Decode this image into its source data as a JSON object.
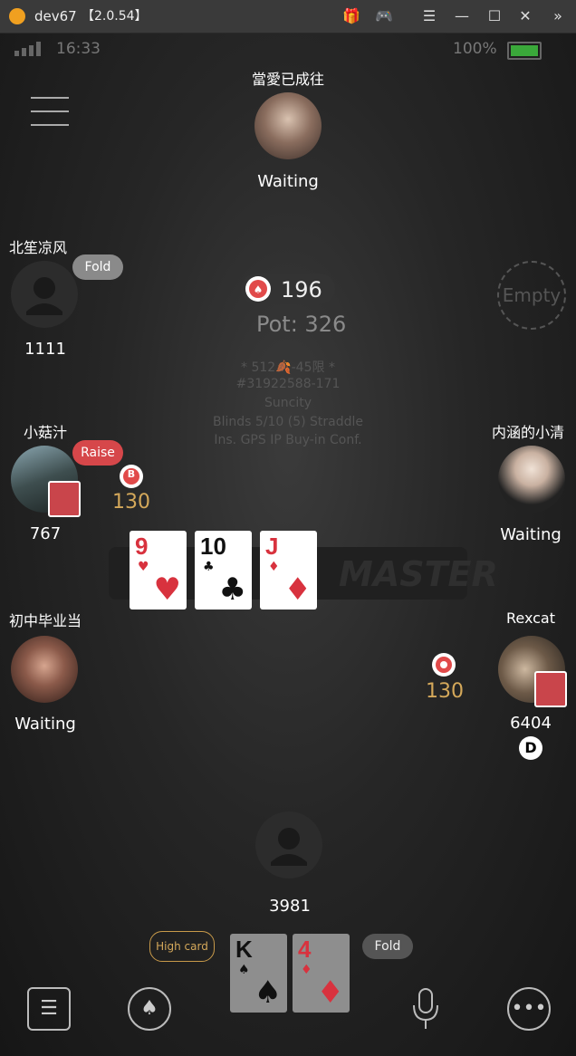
{
  "window": {
    "app": "dev67",
    "version": "【2.0.54】"
  },
  "status": {
    "time": "16:33",
    "battery": "100%"
  },
  "table": {
    "bet": "196",
    "pot": "Pot: 326",
    "info": [
      "* 512🍂-45限 *",
      "#31922588-171",
      "Suncity",
      "Blinds 5/10 (5) Straddle",
      "Ins. GPS IP Buy-in Conf."
    ],
    "watermark": "MASTER"
  },
  "players": {
    "top": {
      "name": "當愛已成往",
      "status": "Waiting"
    },
    "left1": {
      "name": "北笙凉风",
      "action": "Fold",
      "stack": "1111"
    },
    "empty_seat": {
      "label": "Empty"
    },
    "left2": {
      "name": "小菇汁",
      "action": "Raise",
      "stack": "767",
      "bet": "130",
      "blind": "B"
    },
    "right1": {
      "name": "内涵的小清",
      "status": "Waiting"
    },
    "left3": {
      "name": "初中毕业当",
      "status": "Waiting"
    },
    "right2": {
      "name": "Rexcat",
      "stack": "6404",
      "bet": "130",
      "dealer": "D"
    },
    "hero": {
      "stack": "3981",
      "hand_label": "High card",
      "action": "Fold"
    }
  },
  "board": [
    {
      "rank": "9",
      "suit": "♥",
      "color": "red"
    },
    {
      "rank": "10",
      "suit": "♣",
      "color": "black"
    },
    {
      "rank": "J",
      "suit": "♦",
      "color": "red"
    }
  ],
  "hand": [
    {
      "rank": "K",
      "suit": "♠",
      "color": "black"
    },
    {
      "rank": "4",
      "suit": "♦",
      "color": "red"
    }
  ]
}
